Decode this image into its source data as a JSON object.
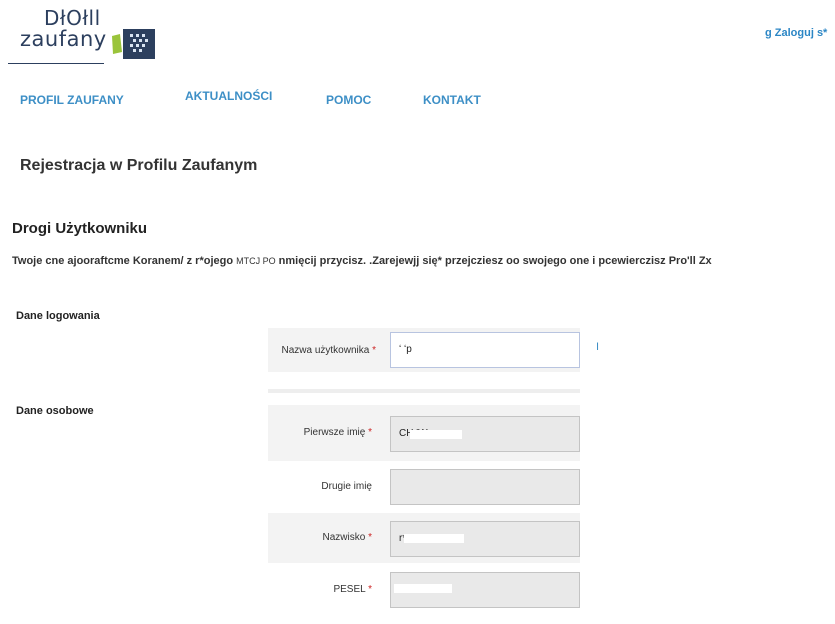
{
  "header": {
    "logo_line1": "DłOłll",
    "logo_line2": "zaufany",
    "login_link": "g Zaloguj s*"
  },
  "nav": [
    {
      "label": "PROFIL ZAUFANY"
    },
    {
      "label": "AKTUALNOŚCI"
    },
    {
      "label": "POMOC"
    },
    {
      "label": "KONTAKT"
    }
  ],
  "page_title": "Rejestracja w Profilu Zaufanym",
  "greeting": "Drogi Użytkowniku",
  "intro": {
    "part1": "Twoje cne ajooraftcme Koranem/ z r*ojego ",
    "small": "MTCJ PO",
    "part2": " nmięcij przycisz. .Zarejewjj się* przejcziesz oo swojego one i pcewierczisz Pro'll Zx"
  },
  "sections": {
    "login": "Dane logowania",
    "personal": "Dane osobowe"
  },
  "fields": {
    "username": {
      "label": "Nazwa użytkownika",
      "required": "*",
      "value": "ʻ  ʻp"
    },
    "first_name": {
      "label": "Pierwsze imię",
      "required": "*",
      "value": "CH                 'W"
    },
    "second_name": {
      "label": "Drugie imię",
      "required": "",
      "value": ""
    },
    "last_name": {
      "label": "Nazwisko",
      "required": "*",
      "value": "r*                 VSKI"
    },
    "pesel": {
      "label": "PESEL",
      "required": "*",
      "value": "             ·.··ʻ‹"
    }
  },
  "info_mark": "I",
  "colors": {
    "accent": "#3d8fc6",
    "brand_dark": "#2c3f5e",
    "brand_green": "#9ac43b",
    "required": "#cc2222"
  }
}
